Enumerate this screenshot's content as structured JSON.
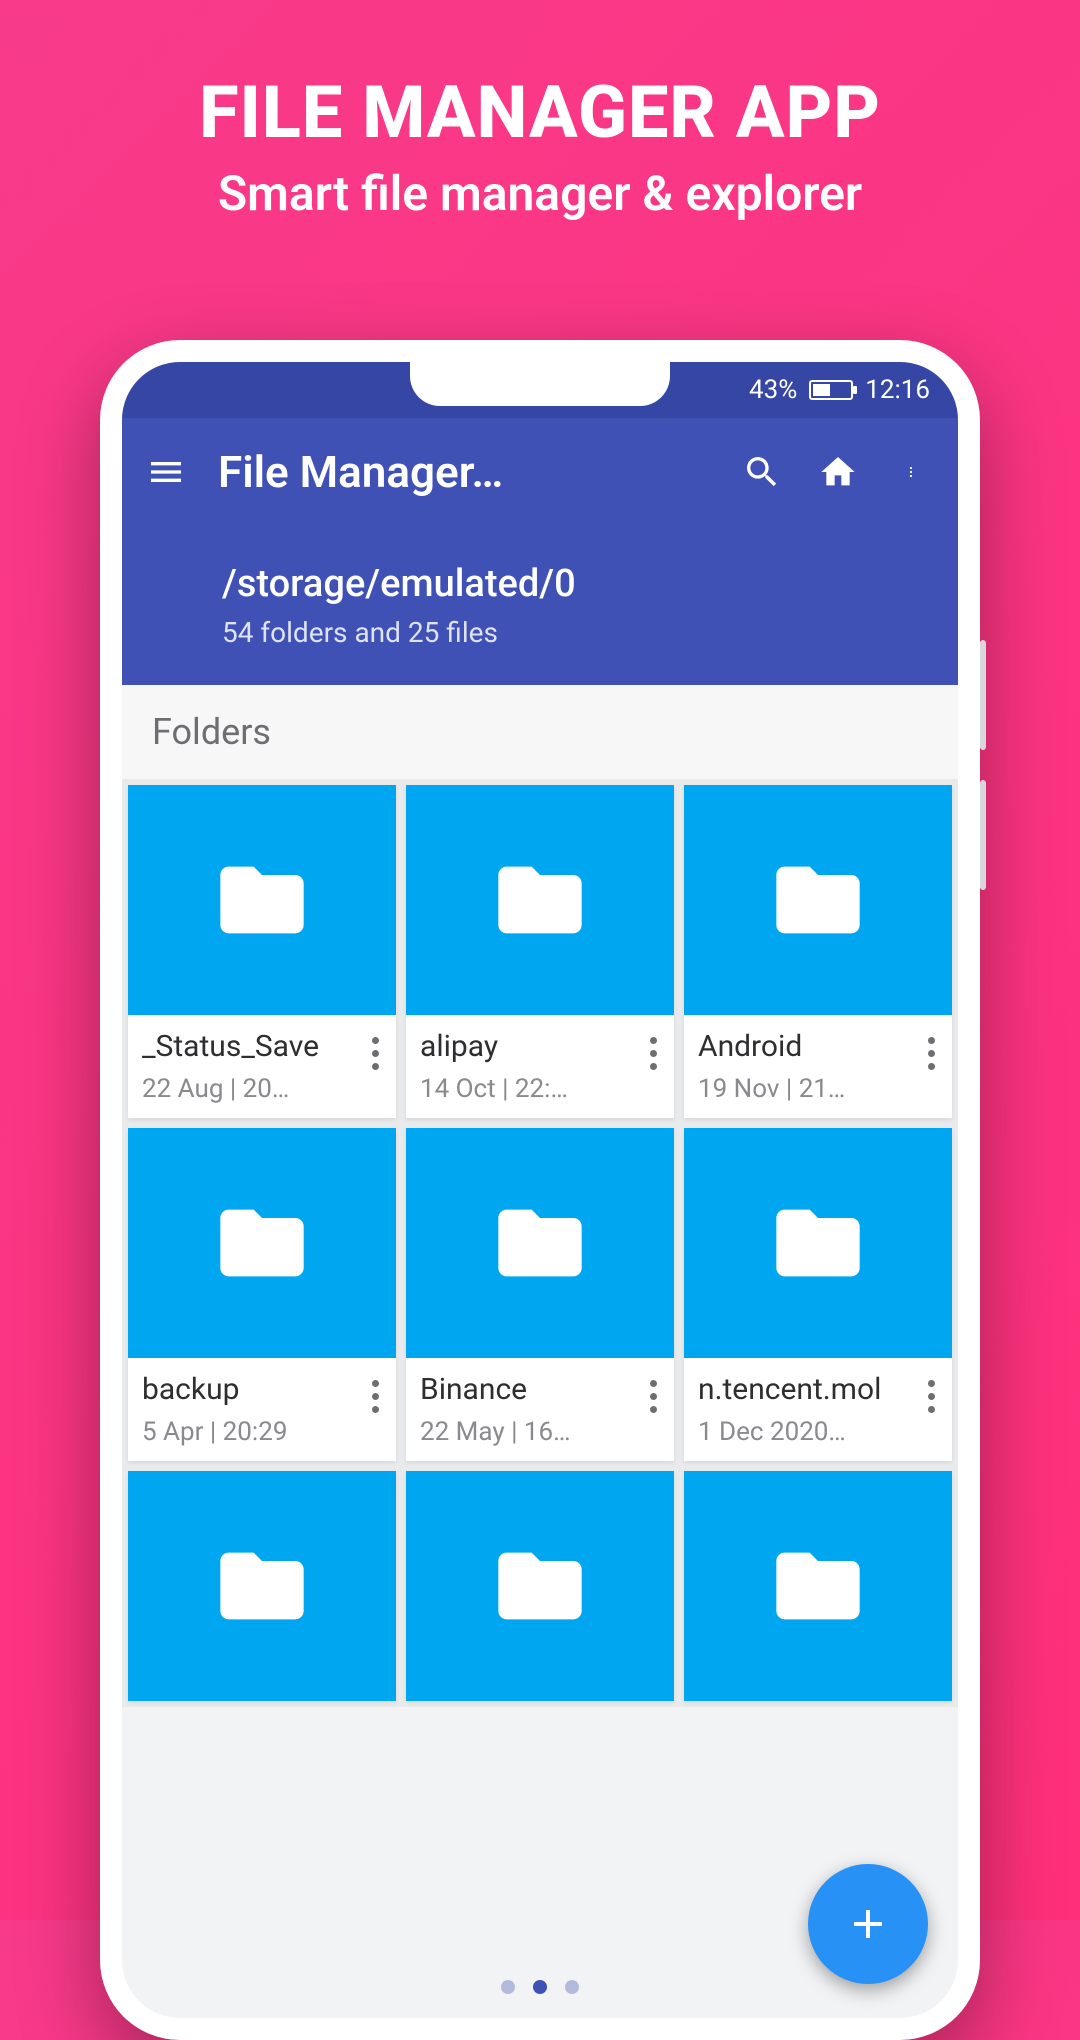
{
  "promo": {
    "title": "FILE MANAGER APP",
    "subtitle": "Smart file manager & explorer"
  },
  "status": {
    "battery_text": "43%",
    "battery_fill_pct": 43,
    "time": "12:16"
  },
  "appbar": {
    "title": "File Manager…",
    "path": "/storage/emulated/0",
    "counts": "54 folders and 25 files"
  },
  "section": {
    "folders_label": "Folders"
  },
  "folders": [
    {
      "name": "_Status_Save",
      "date": "22 Aug | 20…"
    },
    {
      "name": "alipay",
      "date": "14 Oct | 22:…"
    },
    {
      "name": "Android",
      "date": "19 Nov | 21…"
    },
    {
      "name": "backup",
      "date": "5 Apr | 20:29"
    },
    {
      "name": "Binance",
      "date": "22 May | 16…"
    },
    {
      "name": "n.tencent.mol",
      "date": "1 Dec 2020…"
    },
    {
      "name": "",
      "date": ""
    },
    {
      "name": "",
      "date": ""
    },
    {
      "name": "",
      "date": ""
    }
  ],
  "pager": {
    "count": 3,
    "active": 1
  }
}
